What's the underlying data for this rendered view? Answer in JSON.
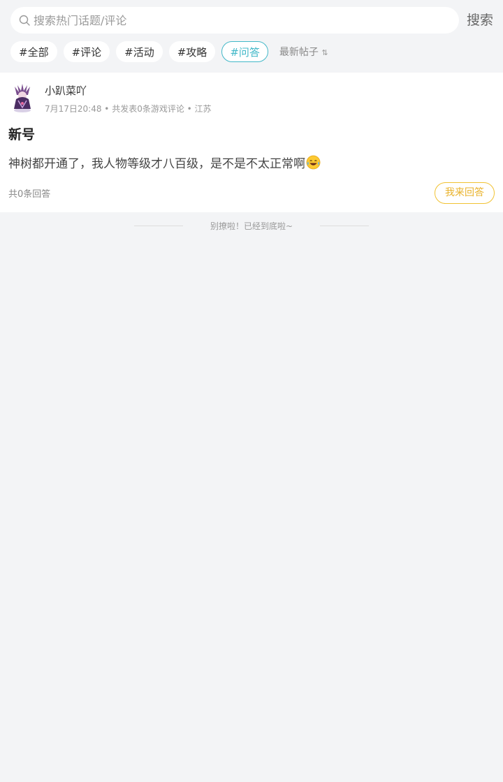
{
  "search": {
    "placeholder": "搜索热门话题/评论",
    "button_label": "搜索"
  },
  "tags": [
    "#全部",
    "#评论",
    "#活动",
    "#攻略",
    "#问答"
  ],
  "active_tag": "#问答",
  "sort": {
    "label": "最新帖子",
    "icon": "sort-arrows-icon"
  },
  "post": {
    "username": "小趴菜吖",
    "meta": "7月17日20:48 • 共发表0条游戏评论 • 江苏",
    "title": "新号",
    "body": "神树都开通了，我人物等级才八百级，是不是不太正常啊",
    "emoji": "laughing-tears-emoji",
    "answer_count": "共0条回答",
    "answer_button": "我来回答"
  },
  "footer": {
    "end_text": "别撩啦！已经到底啦~"
  },
  "colors": {
    "accent": "#42b8c8",
    "answer": "#f1c232",
    "background": "#f3f4f6"
  }
}
